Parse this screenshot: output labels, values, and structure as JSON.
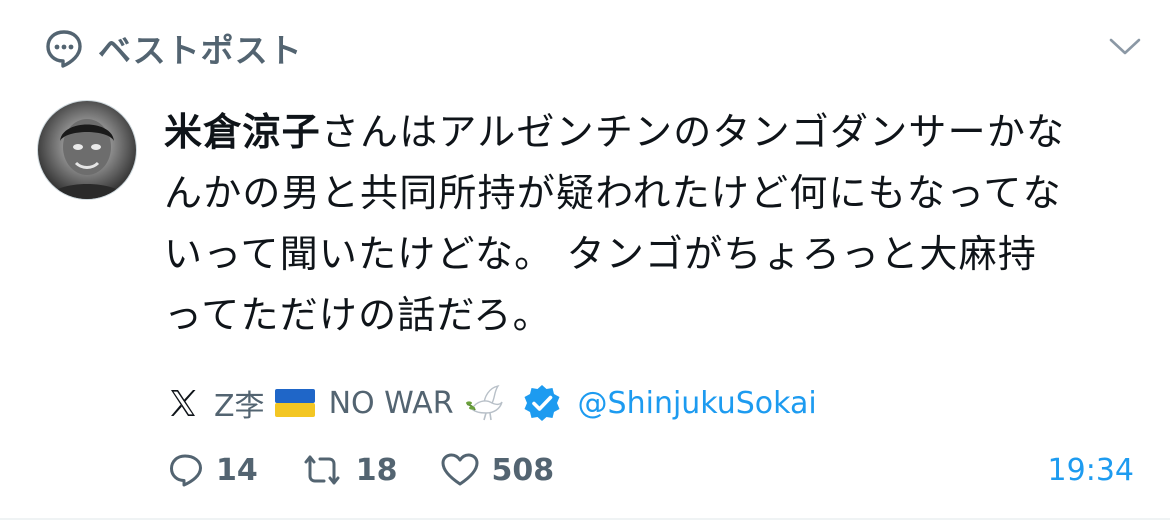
{
  "header": {
    "title": "ベストポスト",
    "icon": "speech-bubble-icon"
  },
  "post": {
    "author_name": "米倉涼子",
    "text": "さんはアルゼンチンのタンゴダンサーかなんかの男と共同所持が疑われたけど何にもなってないって聞いたけどな。 タンゴがちょろっと大麻持ってただけの話だろ。"
  },
  "source": {
    "account_name": "Z李",
    "slogan": "NO WAR",
    "handle": "@ShinjukuSokai"
  },
  "stats": {
    "replies": "14",
    "reposts": "18",
    "likes": "508",
    "time": "19:34"
  },
  "colors": {
    "accent": "#1d9bf0",
    "muted": "#536471",
    "text": "#0f1419"
  }
}
